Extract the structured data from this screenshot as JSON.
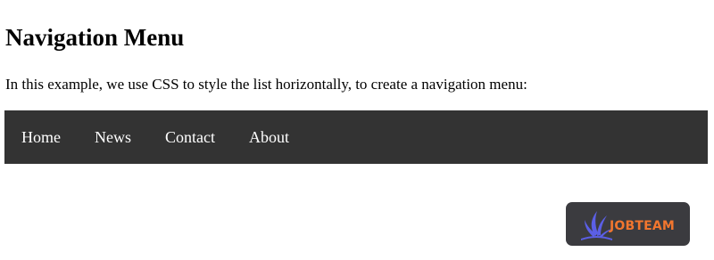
{
  "heading": "Navigation Menu",
  "intro": "In this example, we use CSS to style the list horizontally, to create a navigation menu:",
  "nav": {
    "background_color": "#333333",
    "text_color": "#ffffff",
    "items": [
      {
        "label": "Home"
      },
      {
        "label": "News"
      },
      {
        "label": "Contact"
      },
      {
        "label": "About"
      }
    ]
  },
  "watermark": {
    "brand": "JOBTEAM",
    "icon": "jobteam-logo-icon",
    "brand_color": "#f2762e",
    "icon_color": "#5b5fe6",
    "background_color": "#3b3b3f"
  }
}
